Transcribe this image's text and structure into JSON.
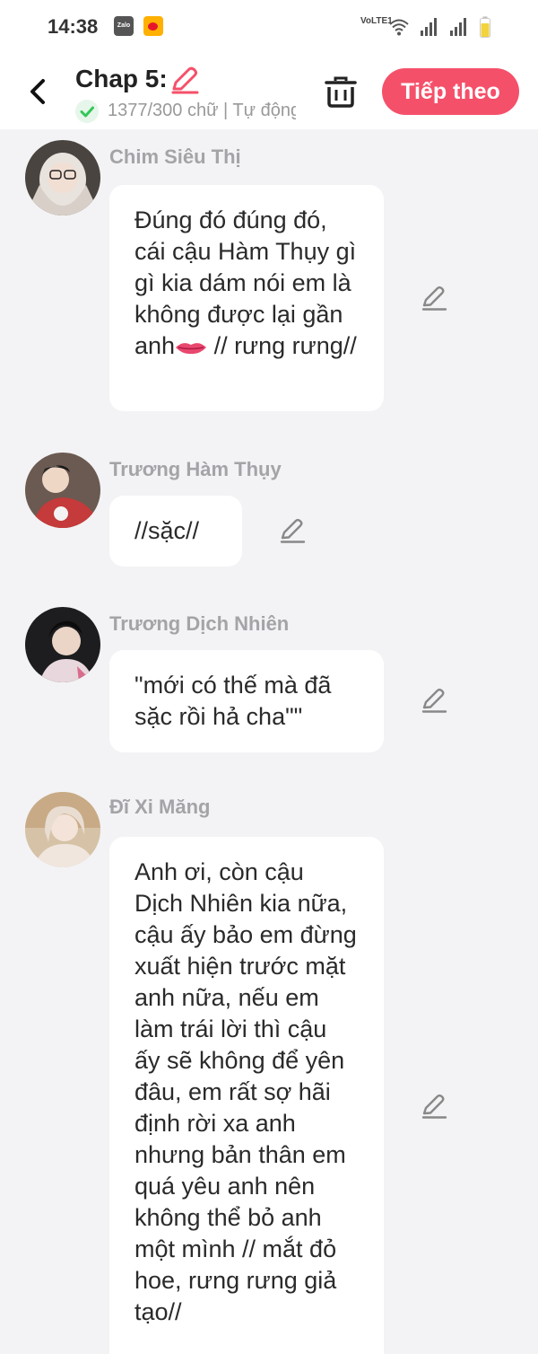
{
  "status_bar": {
    "time": "14:38",
    "apps": [
      "zalo-icon",
      "weibo-icon"
    ],
    "network_label": "VoLTE1",
    "zalo_label": "Zalo"
  },
  "header": {
    "title": "Chap 5:",
    "meta": "1377/300 chữ | Tự động lưu",
    "next_button": "Tiếp theo"
  },
  "colors": {
    "accent": "#f5506a",
    "background": "#f3f3f5",
    "bubble": "#ffffff",
    "name_text": "#a4a4a8",
    "check_green": "#34c759"
  },
  "messages": [
    {
      "name": "Chim Siêu Thị",
      "text_main": "Đúng đó đúng đó, cái cậu Hàm Thụy gì gì kia dám nói em là không được lại gần anh",
      "emoji": "lips-emoji",
      "text_tail": " // rưng rưng//"
    },
    {
      "name": "Trương Hàm Thụy",
      "text": "//sặc//"
    },
    {
      "name": "Trương Dịch Nhiên",
      "text": "\"mới có thế mà đã sặc rồi hả cha\"\""
    },
    {
      "name": "Đĩ Xi Măng",
      "text": "Anh ơi, còn cậu Dịch Nhiên kia nữa, cậu ấy bảo em đừng xuất hiện trước mặt anh nữa, nếu em làm trái lời thì cậu ấy sẽ không để yên đâu, em rất sợ hãi định rời xa anh nhưng bản thân em quá yêu anh nên không thể bỏ anh một mình  // mắt đỏ hoe, rưng rưng giả tạo//"
    }
  ]
}
